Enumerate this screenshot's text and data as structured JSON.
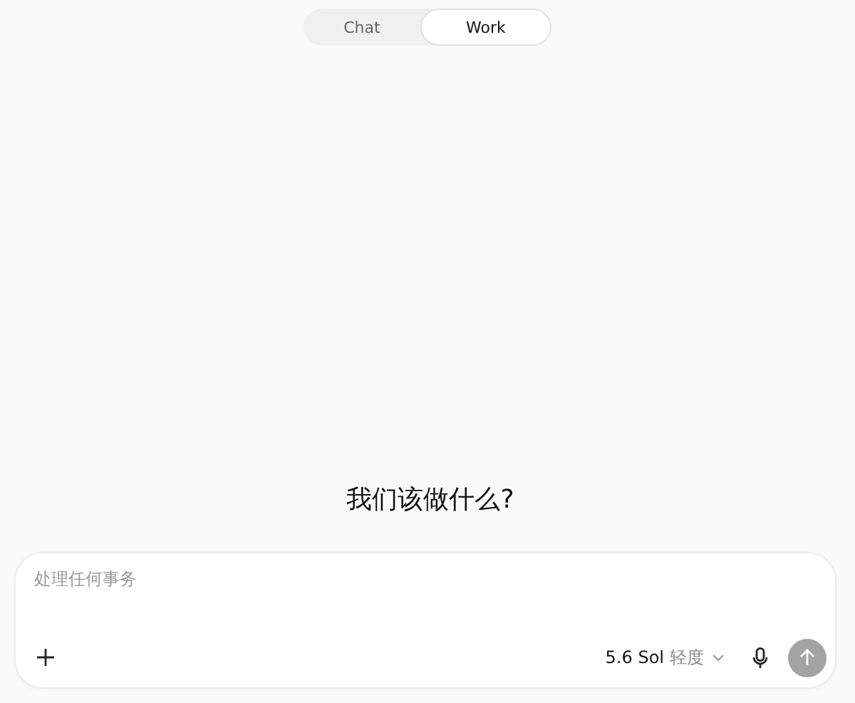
{
  "tabs": [
    {
      "label": "Chat",
      "selected": false
    },
    {
      "label": "Work",
      "selected": true
    }
  ],
  "heading": "我们该做什么?",
  "composer": {
    "placeholder": "处理任何事务",
    "model": "5.6 Sol",
    "effort": "轻度",
    "send_disabled": true
  }
}
